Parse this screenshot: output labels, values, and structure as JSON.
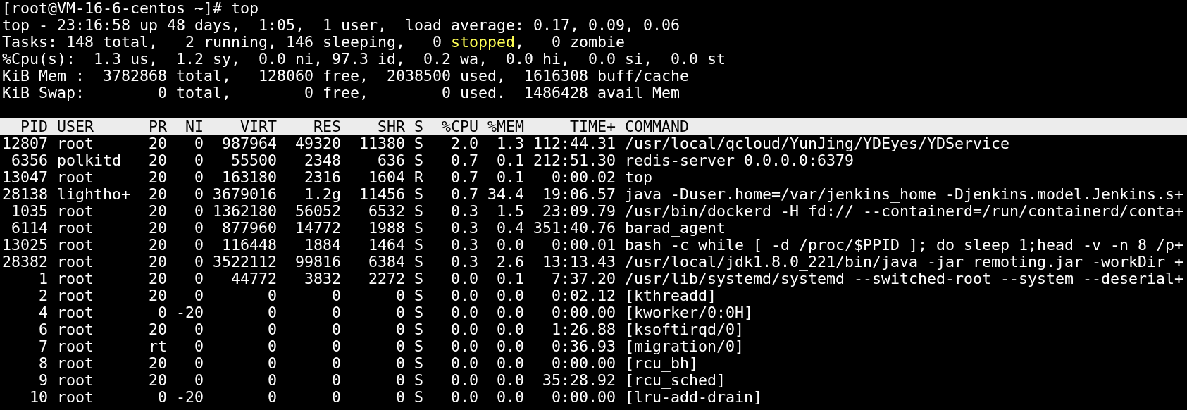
{
  "prompt": "[root@VM-16-6-centos ~]# top",
  "summary": [
    {
      "parts": [
        {
          "text": "top - 23:16:58 up 48 days,  1:05,  1 user,  load average: 0.17, 0.09, 0.06",
          "highlight": false
        }
      ]
    },
    {
      "parts": [
        {
          "text": "Tasks: 148 total,   2 running, 146 sleeping,   0 ",
          "highlight": false
        },
        {
          "text": "stopped",
          "highlight": true
        },
        {
          "text": ",   0 zombie",
          "highlight": false
        }
      ]
    },
    {
      "parts": [
        {
          "text": "%Cpu(s):  1.3 us,  1.2 sy,  0.0 ni, 97.3 id,  0.2 wa,  0.0 hi,  0.0 si,  0.0 st",
          "highlight": false
        }
      ]
    },
    {
      "parts": [
        {
          "text": "KiB Mem :  3782868 total,   128060 free,  2038500 used,  1616308 buff/cache",
          "highlight": false
        }
      ]
    },
    {
      "parts": [
        {
          "text": "KiB Swap:        0 total,        0 free,        0 used.  1486428 avail Mem",
          "highlight": false
        }
      ]
    }
  ],
  "table": {
    "columns": [
      "PID",
      "USER",
      "PR",
      "NI",
      "VIRT",
      "RES",
      "SHR",
      "S",
      "%CPU",
      "%MEM",
      "TIME+",
      "COMMAND"
    ],
    "rows": [
      [
        "12807",
        "root",
        "20",
        "0",
        "987964",
        "49320",
        "11380",
        "S",
        "2.0",
        "1.3",
        "112:44.31",
        "/usr/local/qcloud/YunJing/YDEyes/YDService"
      ],
      [
        "6356",
        "polkitd",
        "20",
        "0",
        "55500",
        "2348",
        "636",
        "S",
        "0.7",
        "0.1",
        "212:51.30",
        "redis-server 0.0.0.0:6379"
      ],
      [
        "13047",
        "root",
        "20",
        "0",
        "163180",
        "2316",
        "1604",
        "R",
        "0.7",
        "0.1",
        "0:00.02",
        "top"
      ],
      [
        "28138",
        "lightho+",
        "20",
        "0",
        "3679016",
        "1.2g",
        "11456",
        "S",
        "0.7",
        "34.4",
        "19:06.57",
        "java -Duser.home=/var/jenkins_home -Djenkins.model.Jenkins.s+"
      ],
      [
        "1035",
        "root",
        "20",
        "0",
        "1362180",
        "56052",
        "6532",
        "S",
        "0.3",
        "1.5",
        "23:09.79",
        "/usr/bin/dockerd -H fd:// --containerd=/run/containerd/conta+"
      ],
      [
        "6114",
        "root",
        "20",
        "0",
        "877960",
        "14772",
        "1988",
        "S",
        "0.3",
        "0.4",
        "351:40.76",
        "barad_agent"
      ],
      [
        "13025",
        "root",
        "20",
        "0",
        "116448",
        "1884",
        "1464",
        "S",
        "0.3",
        "0.0",
        "0:00.01",
        "bash -c while [ -d /proc/$PPID ]; do sleep 1;head -v -n 8 /p+"
      ],
      [
        "28382",
        "root",
        "20",
        "0",
        "3522112",
        "99816",
        "6384",
        "S",
        "0.3",
        "2.6",
        "13:13.43",
        "/usr/local/jdk1.8.0_221/bin/java -jar remoting.jar -workDir +"
      ],
      [
        "1",
        "root",
        "20",
        "0",
        "44772",
        "3832",
        "2272",
        "S",
        "0.0",
        "0.1",
        "7:37.20",
        "/usr/lib/systemd/systemd --switched-root --system --deserial+"
      ],
      [
        "2",
        "root",
        "20",
        "0",
        "0",
        "0",
        "0",
        "S",
        "0.0",
        "0.0",
        "0:02.12",
        "[kthreadd]"
      ],
      [
        "4",
        "root",
        "0",
        "-20",
        "0",
        "0",
        "0",
        "S",
        "0.0",
        "0.0",
        "0:00.00",
        "[kworker/0:0H]"
      ],
      [
        "6",
        "root",
        "20",
        "0",
        "0",
        "0",
        "0",
        "S",
        "0.0",
        "0.0",
        "1:26.88",
        "[ksoftirqd/0]"
      ],
      [
        "7",
        "root",
        "rt",
        "0",
        "0",
        "0",
        "0",
        "S",
        "0.0",
        "0.0",
        "0:36.93",
        "[migration/0]"
      ],
      [
        "8",
        "root",
        "20",
        "0",
        "0",
        "0",
        "0",
        "S",
        "0.0",
        "0.0",
        "0:00.00",
        "[rcu_bh]"
      ],
      [
        "9",
        "root",
        "20",
        "0",
        "0",
        "0",
        "0",
        "S",
        "0.0",
        "0.0",
        "35:28.92",
        "[rcu_sched]"
      ],
      [
        "10",
        "root",
        "0",
        "-20",
        "0",
        "0",
        "0",
        "S",
        "0.0",
        "0.0",
        "0:00.00",
        "[lru-add-drain]"
      ]
    ]
  }
}
